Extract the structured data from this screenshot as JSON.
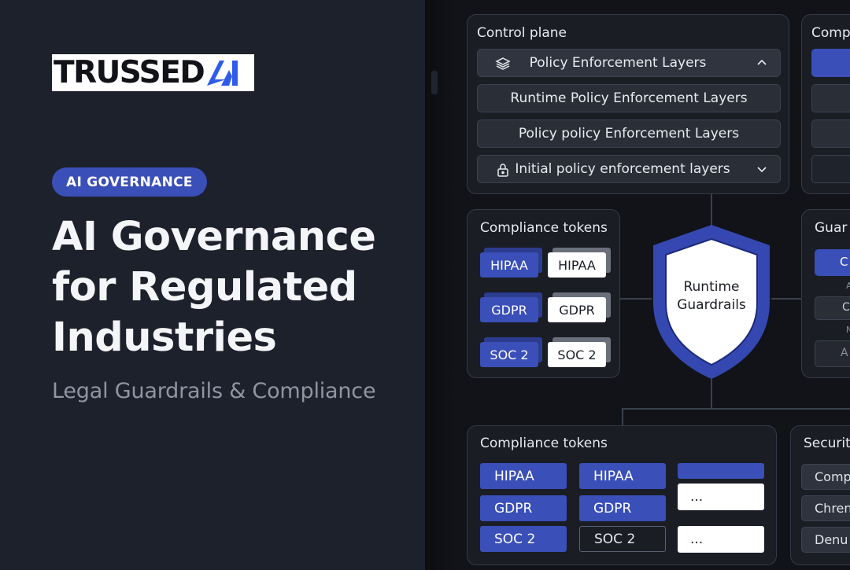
{
  "hero": {
    "logo_text": "TRUSSED",
    "logo_mark_text": "AI",
    "badge": "AI GOVERNANCE",
    "headline_lines": [
      "AI Governance",
      "for Regulated",
      "Industries"
    ],
    "subtitle": "Legal Guardrails & Compliance"
  },
  "control_plane": {
    "title": "Control plane",
    "rows": [
      {
        "label": "Policy Enforcement Layers",
        "icon": "layers-icon",
        "indicator": "chevron-up-icon"
      },
      {
        "label": "Runtime Policy Enforcement Layers"
      },
      {
        "label": "Policy policy Enforcement Layers"
      },
      {
        "label": "Initial policy enforcement layers",
        "icon": "lock-icon",
        "indicator": "chevron-down-icon"
      }
    ]
  },
  "compliance_tokens_small": {
    "title": "Compliance tokens",
    "rows": [
      {
        "blue": "HIPAA",
        "white": "HIPAA"
      },
      {
        "blue": "GDPR",
        "white": "GDPR"
      },
      {
        "blue": "SOC 2",
        "white": "SOC 2"
      }
    ]
  },
  "shield": {
    "line1": "Runtime",
    "line2": "Guardrails"
  },
  "compliance_tokens_large": {
    "title": "Compliance tokens",
    "col1": [
      "HIPAA",
      "GDPR",
      "SOC 2"
    ],
    "col2": [
      "HIPAA",
      "GDPR",
      "SOC 2"
    ],
    "col3": [
      "",
      "...",
      "..."
    ]
  },
  "right_partials": {
    "top_title": "Comp",
    "guard_title": "Guar",
    "guard_items": [
      "C",
      "A",
      "C",
      "N",
      "A"
    ],
    "security_title": "Securit",
    "security_items": [
      "Comp",
      "Chren",
      "Denu"
    ]
  },
  "colors": {
    "accent": "#3a4fb8",
    "background": "#1d212b",
    "panel": "#1a1d24"
  }
}
